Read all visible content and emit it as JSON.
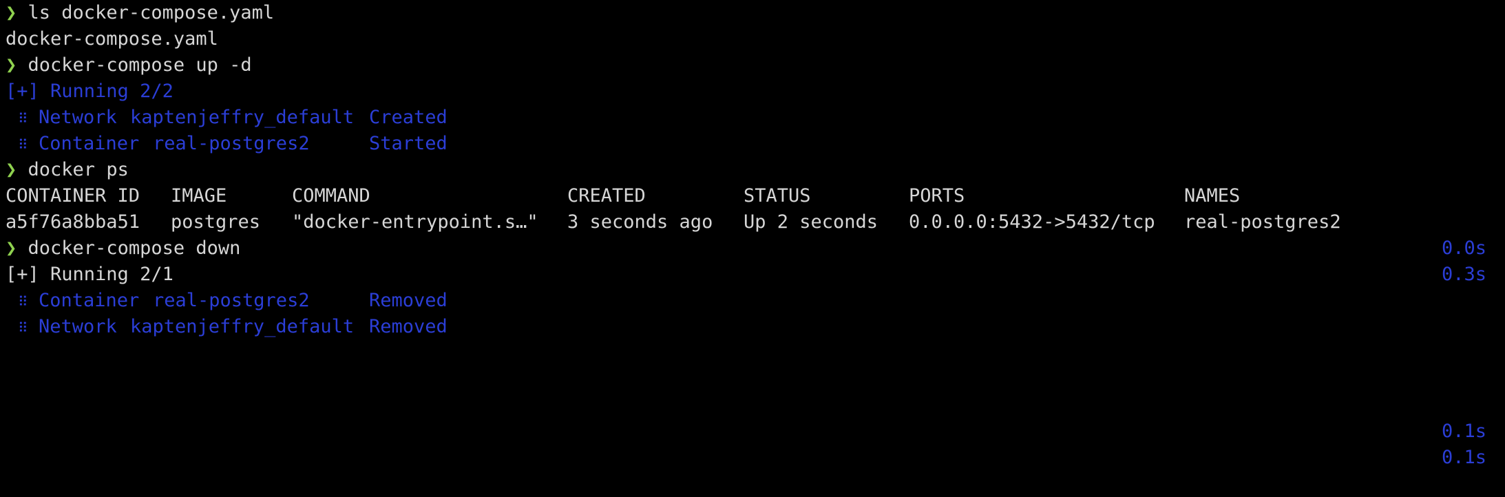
{
  "colors": {
    "background": "#000000",
    "text": "#d6d6d6",
    "prompt": "#8fd14f",
    "progress": "#2b3ed6"
  },
  "prompt_icon": "chevron-right-icon",
  "prompt_glyph": "❯",
  "dots_glyph": "⠿",
  "lines": {
    "cmd1": "ls docker-compose.yaml",
    "out1": "docker-compose.yaml",
    "cmd2": "docker-compose up -d",
    "up_running": "[+] Running 2/2",
    "up_items": [
      {
        "kind": "Network",
        "name": "kaptenjeffry_default",
        "state": "Created",
        "time": "0.0s"
      },
      {
        "kind": "Container",
        "name": "real-postgres2",
        "state": "Started",
        "time": "0.3s"
      }
    ],
    "cmd3": "docker ps",
    "ps_headers": [
      "CONTAINER ID",
      "IMAGE",
      "COMMAND",
      "CREATED",
      "STATUS",
      "PORTS",
      "NAMES"
    ],
    "ps_row": [
      "a5f76a8bba51",
      "postgres",
      "\"docker-entrypoint.s…\"",
      "3 seconds ago",
      "Up 2 seconds",
      "0.0.0.0:5432->5432/tcp",
      "real-postgres2"
    ],
    "cmd4": "docker-compose down",
    "down_running": "[+] Running 2/1",
    "down_items": [
      {
        "kind": "Container",
        "name": "real-postgres2",
        "state": "Removed",
        "time": "0.1s"
      },
      {
        "kind": "Network",
        "name": "kaptenjeffry_default",
        "state": "Removed",
        "time": "0.1s"
      }
    ]
  }
}
